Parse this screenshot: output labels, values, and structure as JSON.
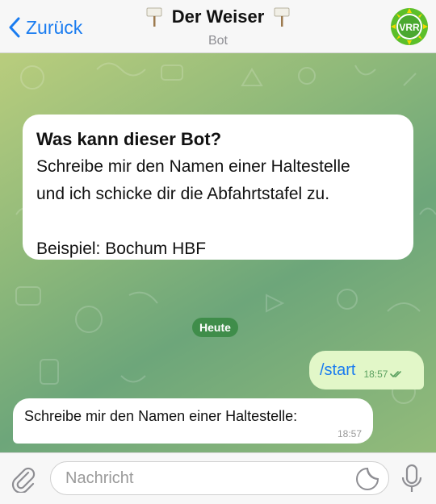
{
  "header": {
    "back_label": "Zurück",
    "bot_name": "Der Weiser",
    "bot_subtitle": "Bot",
    "avatar_text": "VRR",
    "accent_color": "#1a7cf0"
  },
  "chat": {
    "info_card": {
      "title": "Was kann dieser Bot?",
      "line1": "Schreibe mir den Namen einer Haltestelle",
      "line2": "und ich schicke dir die Abfahrtstafel zu.",
      "line3": "Beispiel: Bochum HBF"
    },
    "date_separator": "Heute",
    "messages": [
      {
        "direction": "outgoing",
        "text": "/start",
        "time": "18:57",
        "status": "read"
      },
      {
        "direction": "incoming",
        "text": "Schreibe mir den Namen einer Haltestelle:",
        "time": "18:57"
      }
    ]
  },
  "input": {
    "placeholder": "Nachricht",
    "icons": [
      "paperclip-icon",
      "sticker-icon",
      "microphone-icon"
    ]
  }
}
